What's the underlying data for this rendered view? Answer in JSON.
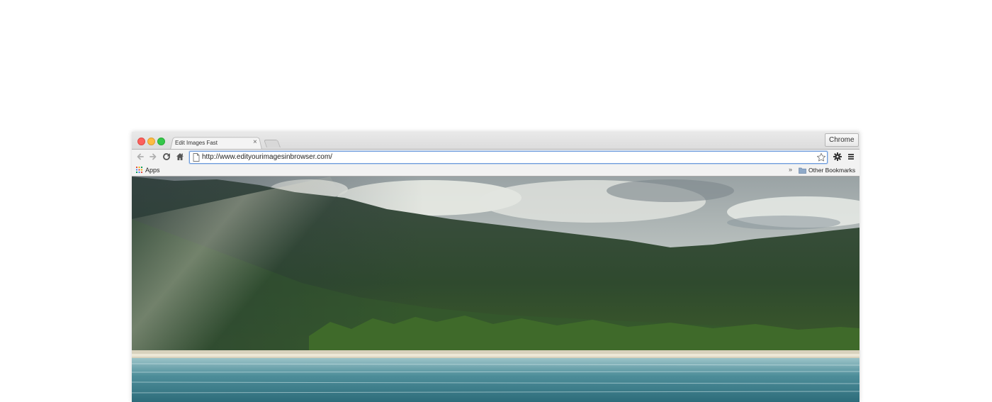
{
  "tab": {
    "title": "Edit Images Fast",
    "close_glyph": "×"
  },
  "profile": {
    "label": "Chrome"
  },
  "omnibox": {
    "url": "http://www.edityourimagesinbrowser.com/"
  },
  "bookmarks": {
    "apps_label": "Apps",
    "overflow_glyph": "»",
    "other_label": "Other Bookmarks"
  },
  "icons": {
    "back": "back-arrow-icon",
    "forward": "forward-arrow-icon",
    "reload": "reload-icon",
    "home": "home-icon",
    "page": "page-icon",
    "star": "star-icon",
    "settings": "gear-icon",
    "menu": "hamburger-menu-icon",
    "apps": "apps-grid-icon",
    "folder": "folder-icon"
  },
  "colors": {
    "close_button": "#fc605c",
    "minimize_button": "#fdbc40",
    "zoom_button": "#34c84a",
    "omnibox_focus": "#6d9cde"
  },
  "content": {
    "image_subject": "landscape-photo"
  }
}
